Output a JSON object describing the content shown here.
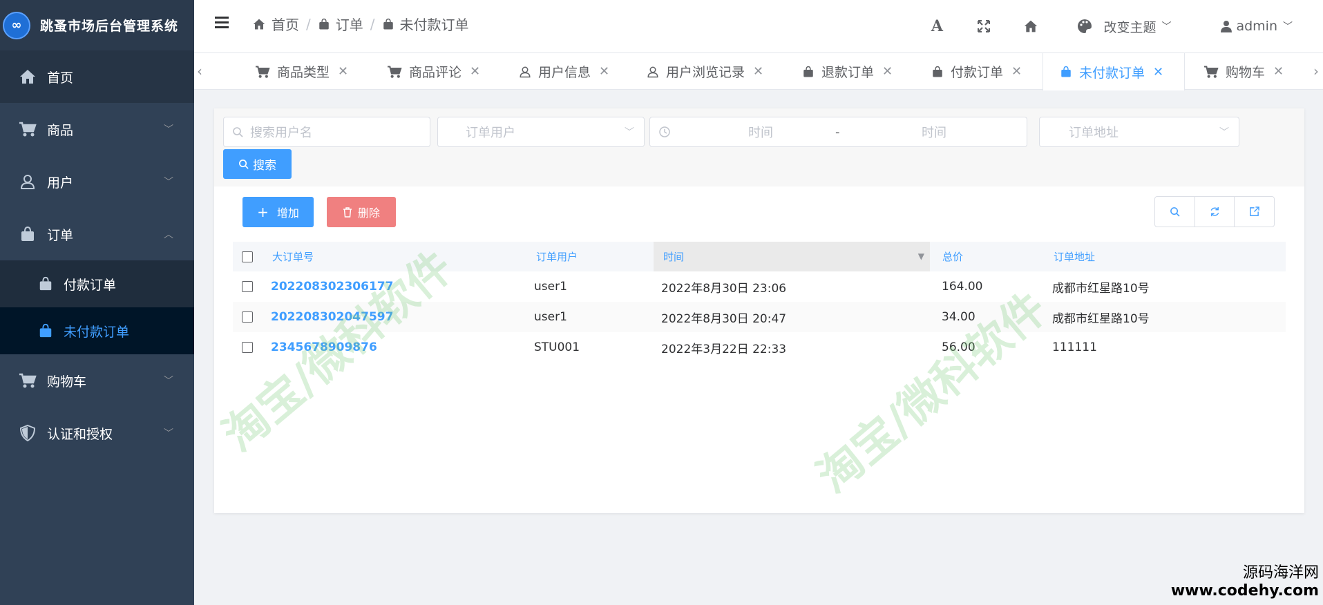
{
  "app": {
    "title": "跳蚤市场后台管理系统"
  },
  "sidebar": {
    "items": [
      {
        "label": "首页",
        "icon": "home-icon"
      },
      {
        "label": "商品",
        "icon": "cart-icon"
      },
      {
        "label": "用户",
        "icon": "user-icon"
      },
      {
        "label": "订单",
        "icon": "bag-icon"
      },
      {
        "label": "付款订单",
        "icon": "bag-icon"
      },
      {
        "label": "未付款订单",
        "icon": "bag-icon"
      },
      {
        "label": "购物车",
        "icon": "cart-icon"
      },
      {
        "label": "认证和授权",
        "icon": "shield-icon"
      }
    ]
  },
  "header": {
    "breadcrumb": [
      "首页",
      "订单",
      "未付款订单"
    ],
    "theme_label": "改变主题",
    "user": "admin"
  },
  "tabs": [
    {
      "label": "商品类型"
    },
    {
      "label": "商品评论"
    },
    {
      "label": "用户信息"
    },
    {
      "label": "用户浏览记录"
    },
    {
      "label": "退款订单"
    },
    {
      "label": "付款订单"
    },
    {
      "label": "未付款订单"
    },
    {
      "label": "购物车"
    }
  ],
  "filter": {
    "username_placeholder": "搜索用户名",
    "order_user_placeholder": "订单用户",
    "time_start_placeholder": "时间",
    "time_sep": "-",
    "time_end_placeholder": "时间",
    "address_placeholder": "订单地址",
    "search_label": "搜索"
  },
  "actions": {
    "add_label": "增加",
    "delete_label": "删除"
  },
  "table": {
    "columns": [
      "大订单号",
      "订单用户",
      "时间",
      "总价",
      "订单地址"
    ],
    "rows": [
      {
        "no": "202208302306177",
        "user": "user1",
        "time": "2022年8月30日 23:06",
        "total": "164.00",
        "address": "成都市红星路10号"
      },
      {
        "no": "202208302047597",
        "user": "user1",
        "time": "2022年8月30日 20:47",
        "total": "34.00",
        "address": "成都市红星路10号"
      },
      {
        "no": "2345678909876",
        "user": "STU001",
        "time": "2022年3月22日 22:33",
        "total": "56.00",
        "address": "111111"
      }
    ]
  },
  "watermarks": {
    "text1": "淘宝/微科软件",
    "text2": "淘宝/微科软件",
    "brand_line1": "源码海洋网",
    "brand_line2": "www.codehy.com"
  }
}
